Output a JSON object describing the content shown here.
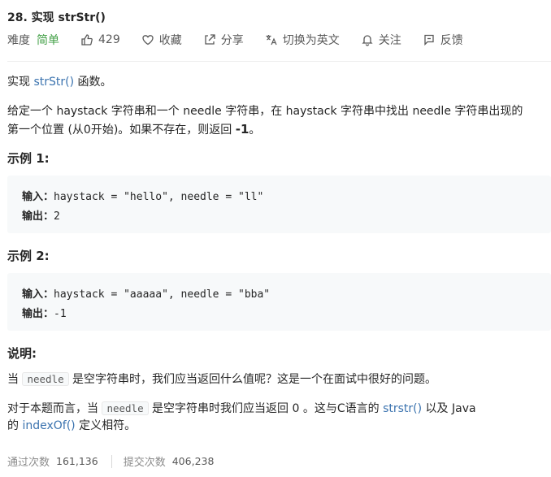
{
  "problem": {
    "title": "28. 实现 strStr()"
  },
  "toolbar": {
    "difficulty_label": "难度",
    "difficulty_value": "简单",
    "likes_count": "429",
    "favorite_label": "收藏",
    "share_label": "分享",
    "switch_lang_label": "切换为英文",
    "follow_label": "关注",
    "feedback_label": "反馈"
  },
  "description": {
    "line1_prefix": "实现 ",
    "line1_link": "strStr()",
    "line1_suffix": " 函数。",
    "para2_line1": "给定一个 haystack 字符串和一个 needle 字符串，在 haystack 字符串中找出 needle 字符串出现的",
    "para2_line2_prefix": "第一个位置 (从0开始)。如果不存在，则返回  ",
    "para2_line2_strong": "-1",
    "para2_line2_suffix": "。"
  },
  "examples": [
    {
      "heading": "示例 1:",
      "input_label": "输入：",
      "input_value": "haystack = \"hello\", needle = \"ll\"",
      "output_label": "输出：",
      "output_value": "2"
    },
    {
      "heading": "示例 2:",
      "input_label": "输入：",
      "input_value": "haystack = \"aaaaa\", needle = \"bba\"",
      "output_label": "输出：",
      "output_value": "-1"
    }
  ],
  "notes": {
    "heading": "说明:",
    "line1_prefix": "当 ",
    "line1_code": "needle",
    "line1_suffix": " 是空字符串时，我们应当返回什么值呢？这是一个在面试中很好的问题。",
    "line2_prefix": "对于本题而言，当 ",
    "line2_code": "needle",
    "line2_mid": " 是空字符串时我们应当返回 0 。这与C语言的 ",
    "line2_link1": "strstr()",
    "line2_suffix": " 以及 Java",
    "line3_prefix": "的 ",
    "line3_link": "indexOf()",
    "line3_suffix": " 定义相符。"
  },
  "stats": {
    "accepted_label": "通过次数",
    "accepted_value": "161,136",
    "submissions_label": "提交次数",
    "submissions_value": "406,238"
  },
  "colors": {
    "difficulty_easy": "#43a047",
    "link": "#3b73af",
    "code_bg": "#f7f9fa"
  },
  "icons": [
    "thumbs-up-icon",
    "heart-icon",
    "share-icon",
    "translate-icon",
    "bell-icon",
    "feedback-icon"
  ]
}
